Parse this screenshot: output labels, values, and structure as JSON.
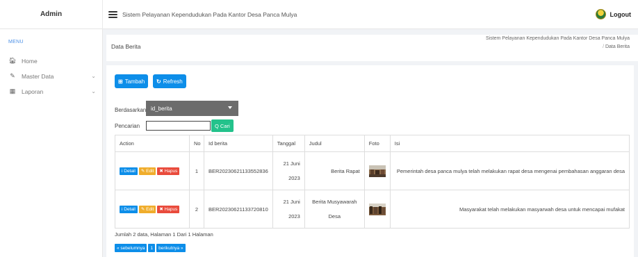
{
  "header": {
    "brand": "Admin",
    "title": "Sistem Pelayanan Kependudukan Pada Kantor Desa Panca Mulya",
    "logout": "Logout"
  },
  "sidebar": {
    "heading": "MENU",
    "items": [
      {
        "label": "Home",
        "icon": "home-icon"
      },
      {
        "label": "Master Data",
        "icon": "edit-icon"
      },
      {
        "label": "Laporan",
        "icon": "calendar-icon"
      }
    ]
  },
  "page": {
    "title": "Data Berita",
    "breadcrumb": {
      "root": "Sistem Pelayanan Kependudukan Pada Kantor Desa Panca Mulya",
      "sep": "/",
      "current": "Data Berita"
    }
  },
  "toolbar": {
    "tambah": "Tambah",
    "refresh": "Refresh"
  },
  "filter": {
    "label": "Berdasarkan",
    "selected": "id_berita",
    "search_label": "Pencarian",
    "search_value": "",
    "search_button": "Q Cari"
  },
  "table": {
    "headers": [
      "Action",
      "No",
      "Id berita",
      "Tanggal",
      "Judul",
      "Foto",
      "Isi"
    ],
    "actions": {
      "detail": "i Detail",
      "edit": "Edit",
      "hapus": "Hapus"
    },
    "rows": [
      {
        "no": "1",
        "id": "BER20230621133552836",
        "tanggal": "21 Juni 2023",
        "judul": "Berita Rapat",
        "isi": "Pemerintah desa panca mulya telah melakukan rapat desa mengenai pembahasan anggaran desa"
      },
      {
        "no": "2",
        "id": "BER20230621133720810",
        "tanggal": "21 Juni 2023",
        "judul": "Berita Musyawarah Desa",
        "isi": "Masyarakat telah melakukan masyarwah desa untuk mencapai mufakat"
      }
    ]
  },
  "summary": "Jumlah 2 data, Halaman 1 Dari 1 Halaman",
  "pager": {
    "prev": "« sebelumnya",
    "page": "1",
    "next": "berikutnya »"
  },
  "colors": {
    "primary": "#0d8ee9",
    "success": "#23c28b",
    "warning": "#f0ad2c",
    "danger": "#e94b3c"
  }
}
